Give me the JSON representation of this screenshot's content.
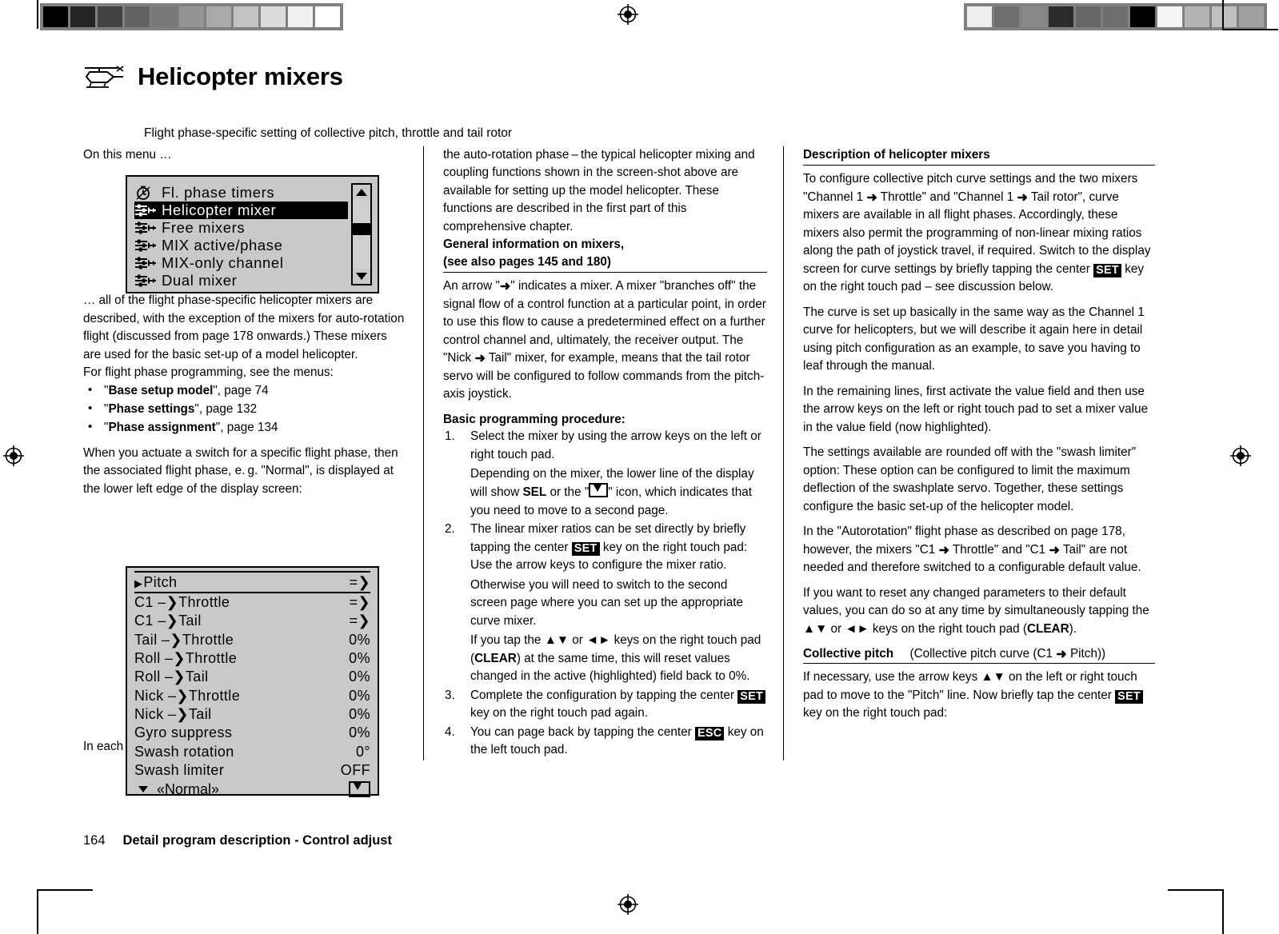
{
  "document": {
    "title": "Helicopter mixers",
    "title_icon": "helicopter-icon",
    "subtitle": "Flight phase-specific setting of collective pitch, throttle and tail rotor",
    "footer": {
      "page_number": "164",
      "chapter": "Detail program description - Control adjust"
    }
  },
  "column_left": {
    "intro": "On this menu …",
    "lcd_menu": {
      "rows": [
        {
          "icon": "stopwatch-icon",
          "label": "Fl. phase timers",
          "selected": false
        },
        {
          "icon": "mixer-icon",
          "label": "Helicopter mixer",
          "selected": true
        },
        {
          "icon": "mixer-icon",
          "label": "Free mixers",
          "selected": false
        },
        {
          "icon": "mixer-icon",
          "label": "MIX active/phase",
          "selected": false
        },
        {
          "icon": "mixer-icon",
          "label": "MIX-only channel",
          "selected": false
        },
        {
          "icon": "mixer-icon",
          "label": "Dual mixer",
          "selected": false
        }
      ],
      "scrollbar": {
        "up_icon": "triangle-up-icon",
        "down_icon": "triangle-down-icon"
      }
    },
    "para1": "… all of the flight phase-specific helicopter mixers are described, with the exception of the mixers for auto-rotation flight (discussed from page 178 onwards.) These mixers are used for the basic set-up of a model helicopter.",
    "para2": "For flight phase programming, see the menus:",
    "bullets": [
      {
        "bold": "Base setup model",
        "rest": ", page 74"
      },
      {
        "bold": "Phase settings",
        "rest": ", page 132"
      },
      {
        "bold": "Phase assignment",
        "rest": ", page 134"
      }
    ],
    "para3": "When you actuate a switch for a specific flight phase, then the associated flight phase, e. g. \"Normal\", is displayed at the lower left edge of the display screen:",
    "lcd_mixer": {
      "rows": [
        {
          "cursor": true,
          "name": "Pitch",
          "value": "=❯"
        },
        {
          "cursor": false,
          "name": "C1   –❯Throttle",
          "value": "=❯"
        },
        {
          "cursor": false,
          "name": "C1   –❯Tail",
          "value": "=❯"
        },
        {
          "cursor": false,
          "name": "Tail –❯Throttle",
          "value": "0%"
        },
        {
          "cursor": false,
          "name": "Roll –❯Throttle",
          "value": "0%"
        },
        {
          "cursor": false,
          "name": "Roll –❯Tail",
          "value": "0%"
        },
        {
          "cursor": false,
          "name": "Nick –❯Throttle",
          "value": "0%"
        },
        {
          "cursor": false,
          "name": "Nick –❯Tail",
          "value": "0%"
        },
        {
          "cursor": false,
          "name": "Gyro suppress",
          "value": "0%"
        },
        {
          "cursor": false,
          "name": "Swash rotation",
          "value": "0°"
        },
        {
          "cursor": false,
          "name": "Swash limiter",
          "value": "OFF"
        }
      ],
      "phase_label": "«Normal»",
      "phase_down_icon": "triangle-down-icon",
      "page_icon": "next-page-icon"
    },
    "para4": "In each of these flight phases – with the exception of"
  },
  "column_middle": {
    "para1": "the auto-rotation phase – the typical helicopter mixing and coupling functions shown in the screen-shot above are available for setting up the model helicopter. These functions are described in the first part of this comprehensive chapter.",
    "heading1_line1": "General information on mixers,",
    "heading1_line2": "(see also pages 145 and 180)",
    "para2_a": "An arrow \"",
    "para2_b": "\" indicates a mixer. A mixer \"branches off\" the signal flow of a control function at a particular point, in order to use this flow to cause a predetermined effect on a further control channel and, ultimately, the receiver output. The \"Nick ",
    "para2_c": " Tail\" mixer, for example, means that the tail rotor servo will be configured to follow commands from the pitch-axis joystick.",
    "heading2": "Basic programming procedure:",
    "steps": [
      {
        "text": "Select the mixer by using the arrow keys on the left or right touch pad.",
        "sub_a": "Depending on the mixer, the lower line of the display will show ",
        "sub_key": "SEL",
        "sub_b": " or the \"",
        "sub_icon": "next-page-icon",
        "sub_c": "\" icon, which indicates that you need to move to a second page."
      },
      {
        "text_a": "The linear mixer ratios can be set directly by briefly tapping the center ",
        "key": "SET",
        "text_b": " key on the right touch pad: Use the arrow keys to configure the mixer ratio.",
        "sub_a": "Otherwise you will need to switch to the second screen page where you can set up the appropriate curve mixer.",
        "sub_b": "If you tap the ▲▼ or ◄► keys on the right touch pad (",
        "sub_key": "CLEAR",
        "sub_c": ") at the same time, this will reset values changed in the active (highlighted) field back to 0%."
      },
      {
        "text_a": "Complete the configuration by tapping the center ",
        "key": "SET",
        "text_b": " key on the right touch pad again."
      },
      {
        "text_a": "You can page back by tapping the center ",
        "key": "ESC",
        "text_b": " key on the left touch pad."
      }
    ]
  },
  "column_right": {
    "heading1": "Description of helicopter mixers",
    "para1_a": "To configure collective pitch curve settings and the two mixers \"Channel 1 ",
    "para1_b": " Throttle\" and \"Channel 1 ",
    "para1_c": " Tail rotor\", curve mixers are available in all flight phases. Accordingly, these mixers also permit the programming of non-linear mixing ratios along the path of joystick travel, if required. Switch to the display screen for curve settings by briefly tapping the center ",
    "para1_key": "SET",
    "para1_d": " key on the right touch pad – see discussion below.",
    "para2": "The curve is set up basically in the same way as the Channel 1 curve for helicopters, but we will describe it again here in detail using pitch configuration as an example, to save you having to leaf through the manual.",
    "para3": "In the remaining lines, first activate the value field and then use the arrow keys on the left or right touch pad to set a mixer value in the value field (now highlighted).",
    "para4": "The settings available are rounded off with the \"swash limiter\" option: These option can be configured to limit the maximum deflection of the swashplate servo. Together, these settings configure the basic set-up of the helicopter model.",
    "para5_a": "In the \"Autorotation\" flight phase as described on page 178, however, the mixers \"C1 ",
    "para5_b": " Throttle\" and \"C1 ",
    "para5_c": " Tail\" are not needed and therefore switched to a configurable default value.",
    "para6_a": "If you want to reset any changed parameters to their default values, you can do so at any time by simultaneously tapping the ▲▼ or ◄► keys on the right touch pad (",
    "para6_key": "CLEAR",
    "para6_b": ").",
    "heading2_bold": "Collective pitch",
    "heading2_rest_a": "(Collective pitch curve (C1 ",
    "heading2_rest_b": " Pitch))",
    "para7_a": "If necessary, use the arrow keys ▲▼ on the left or right touch pad to move to the \"Pitch\" line. Now briefly tap the center ",
    "para7_key": "SET",
    "para7_b": " key on the right touch pad:"
  },
  "calibration": {
    "left_swatches": [
      "#000000",
      "#242424",
      "#434343",
      "#636363",
      "#787878",
      "#949494",
      "#a9a9a9",
      "#c3c3c3",
      "#dcdcdc",
      "#efefef",
      "#ffffff"
    ],
    "right_swatches": [
      "#eeeeee",
      "#6e6e6e",
      "#878787",
      "#2c2c2c",
      "#666666",
      "#6e6e6e",
      "#000000",
      "#f4f4f4",
      "#b4b4b4",
      "#c0c0c0",
      "#a0a0a0"
    ],
    "registration_icon": "registration-mark-icon"
  },
  "colors": {
    "lcd_background": "#c9c9c9",
    "ink": "#000000",
    "paper": "#ffffff"
  }
}
